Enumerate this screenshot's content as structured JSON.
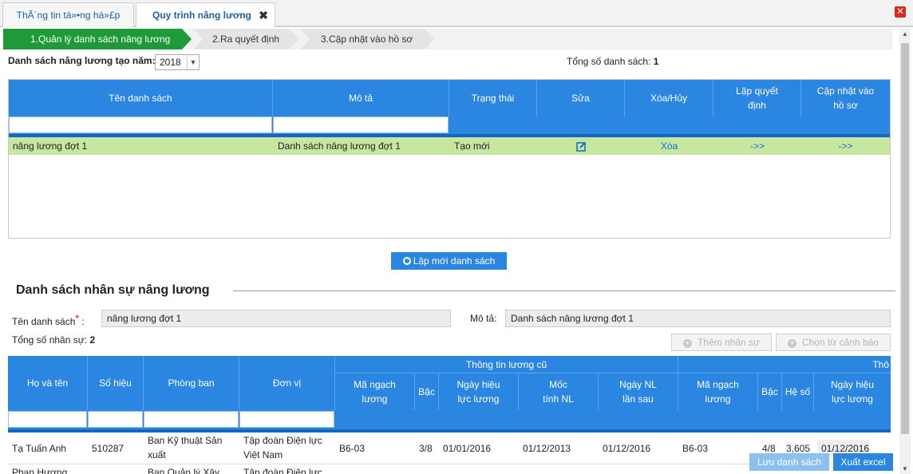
{
  "tabs": [
    {
      "label": "ThĂ´ng tin tá»•ng há»£p"
    },
    {
      "label": "Quy trình nâng lương"
    }
  ],
  "steps": [
    "1.Quản lý danh sách nâng lương",
    "2.Ra quyết định",
    "3.Cập nhật vào hồ sơ"
  ],
  "filter": {
    "year_label": "Danh sách nâng lương tạo năm:",
    "year_value": "2018",
    "total_label": "Tổng số danh sách:",
    "total_value": "1"
  },
  "list_table": {
    "headers": [
      "Tên danh sách",
      "Mô tả",
      "Trạng thái",
      "Sửa",
      "Xóa/Hủy",
      "Lập quyết định",
      "Cập nhật vào hồ sơ"
    ],
    "rows": [
      {
        "name": "nâng lương đợt 1",
        "desc": "Danh sách nâng lương đợt 1",
        "status": "Tạo mới",
        "delete": "Xóa",
        "decision": "->>",
        "update": "->>"
      }
    ]
  },
  "create_button": "Lập mới danh sách",
  "staff_section": {
    "title": "Danh sách nhân sự nâng lương",
    "name_label": "Tên danh sách",
    "required": "*",
    "colon": ":",
    "name_value": "nâng lương đợt 1",
    "desc_label": "Mô tả:",
    "desc_value": "Danh sách nâng lương đợt 1",
    "total_label": "Tổng số nhân sự:",
    "total_value": "2",
    "add_button": "Thêm nhân sự",
    "warn_button": "Chọn từ cảnh báo"
  },
  "staff_table": {
    "headers": [
      "Họ và tên",
      "Số hiệu",
      "Phòng ban",
      "Đơn vị"
    ],
    "group_old": "Thông tin lương cũ",
    "group_new": "Thô",
    "sub_old": [
      "Mã ngạch lương",
      "Bậc",
      "Ngày hiệu lực lương",
      "Mốc tính NL",
      "Ngày NL lần sau"
    ],
    "sub_new": [
      "Mã ngạch lương",
      "Bậc",
      "Hệ số",
      "Ngày hiệu lực lương"
    ],
    "rows": [
      {
        "name": "Tạ Tuấn Anh",
        "code": "510287",
        "dept": "Ban Kỹ thuật Sản xuất",
        "unit": "Tập đoàn Điện lực Việt Nam",
        "old_grade": "B6-03",
        "old_step": "3/8",
        "old_eff": "01/01/2016",
        "old_mark": "01/12/2013",
        "old_next": "01/12/2016",
        "new_grade": "B6-03",
        "new_step": "4/8",
        "new_coef": "3,605",
        "new_eff": "01/12/2016"
      },
      {
        "name": "Phan Hương",
        "dept": "Ban Quản lý Xây",
        "unit": "Tập đoàn Điện lực"
      }
    ]
  },
  "footer": {
    "save": "Lưu danh sách",
    "export": "Xuất excel"
  }
}
